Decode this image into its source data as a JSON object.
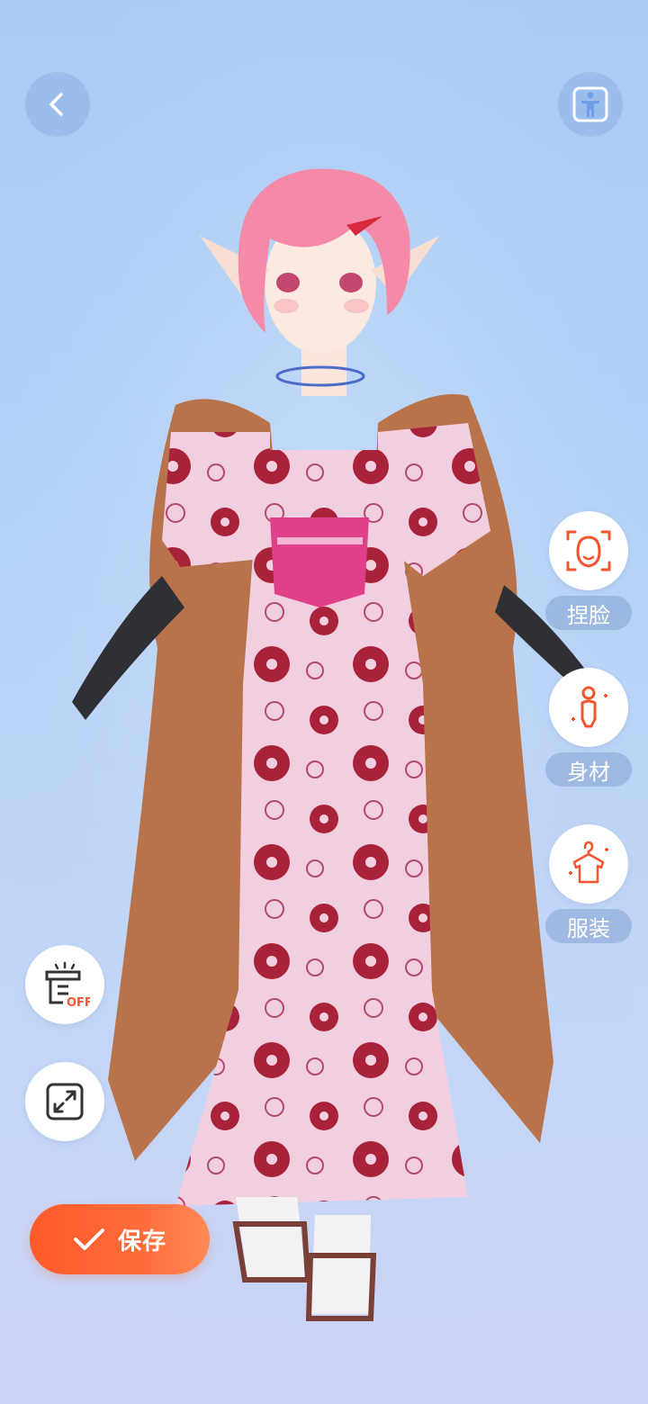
{
  "top_bar": {
    "back_icon": "chevron-left-icon",
    "body_view_icon": "person-standing-icon"
  },
  "side_menu": [
    {
      "id": "face",
      "label": "捏脸",
      "icon": "face-icon"
    },
    {
      "id": "body",
      "label": "身材",
      "icon": "body-icon"
    },
    {
      "id": "outfit",
      "label": "服装",
      "icon": "hanger-shirt-icon"
    }
  ],
  "tools": {
    "lighting_badge": "OFF",
    "lighting_icon": "lamp-icon",
    "fullscreen_icon": "expand-icon"
  },
  "save_button": {
    "label": "保存",
    "icon": "check-icon"
  },
  "colors": {
    "accent": "#ff5a2a",
    "icon_orange": "#f4552f",
    "label_bg": "#7896c8"
  }
}
